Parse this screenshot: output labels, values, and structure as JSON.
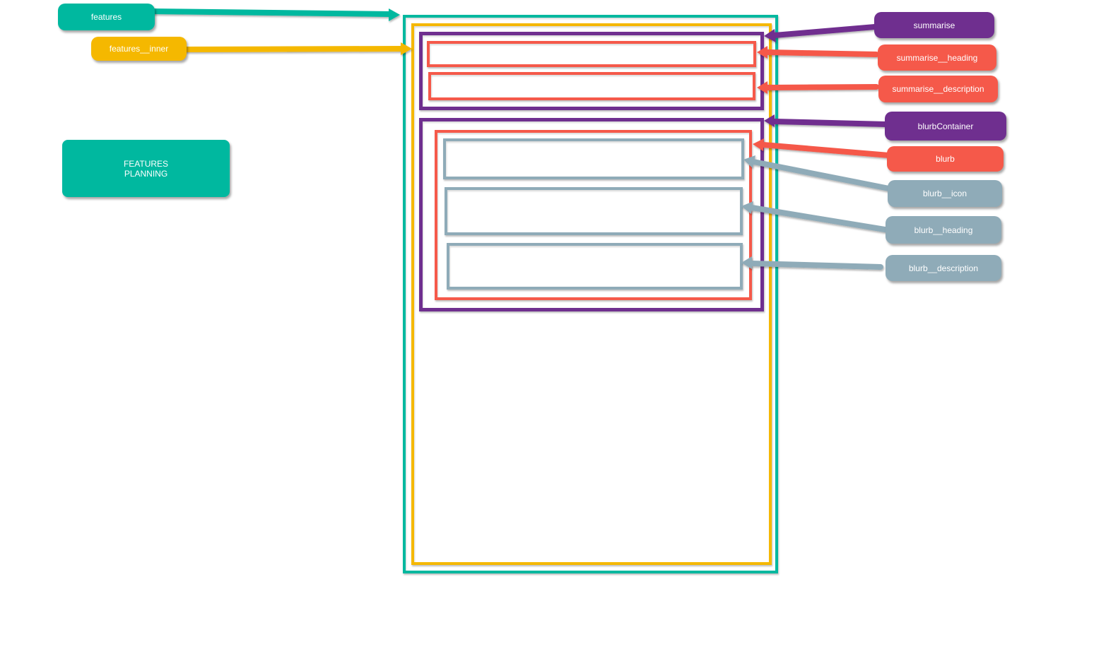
{
  "colors": {
    "features": "#00b89f",
    "features_inner": "#f5b800",
    "summarise": "#6f2f8f",
    "summarise_part": "#f5594a",
    "blurb_part": "#8fabb8"
  },
  "planning": {
    "line1": "FEATURES",
    "line2": "PLANNING"
  },
  "labels": {
    "features": "features",
    "features_inner": "features__inner",
    "summarise": "summarise",
    "summarise_heading": "summarise__heading",
    "summarise_description": "summarise__description",
    "blurbContainer": "blurbContainer",
    "blurb": "blurb",
    "blurb_icon": "blurb__icon",
    "blurb_heading": "blurb__heading",
    "blurb_description": "blurb__description"
  }
}
